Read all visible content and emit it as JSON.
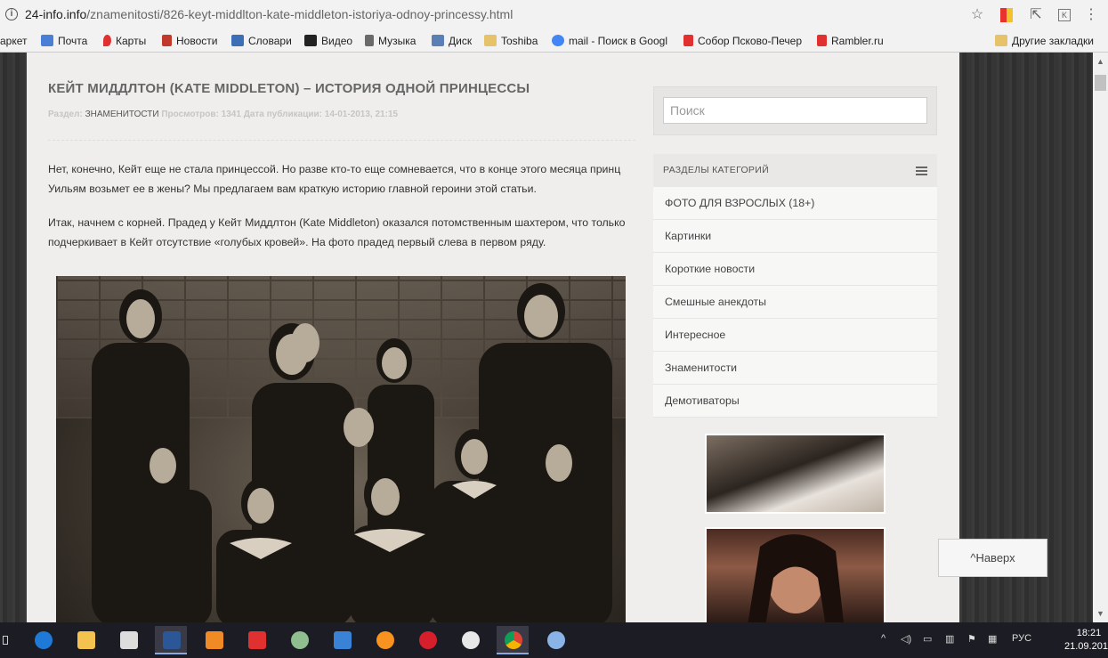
{
  "browser": {
    "url_host": "24-info.info",
    "url_path": "/znamenitosti/826-keyt-middlton-kate-middleton-istoriya-odnoy-princessy.html"
  },
  "bookmarks": [
    {
      "label": "аркет",
      "icon": "yandex-market-icon",
      "color": "#d9534f"
    },
    {
      "label": "Почта",
      "icon": "mail-icon",
      "color": "#4a7fd6"
    },
    {
      "label": "Карты",
      "icon": "map-pin-icon",
      "color": "#e03030"
    },
    {
      "label": "Новости",
      "icon": "news-icon",
      "color": "#c0392b"
    },
    {
      "label": "Словари",
      "icon": "dictionary-icon",
      "color": "#3c6fb5"
    },
    {
      "label": "Видео",
      "icon": "video-icon",
      "color": "#222222"
    },
    {
      "label": "Музыка",
      "icon": "music-icon",
      "color": "#6a6a6a"
    },
    {
      "label": "Диск",
      "icon": "disk-icon",
      "color": "#5a7fb5"
    },
    {
      "label": "Toshiba",
      "icon": "folder-icon",
      "color": "#e6c36a"
    },
    {
      "label": "mail - Поиск в Googl",
      "icon": "google-icon",
      "color": "#4285f4"
    },
    {
      "label": "Собор Псково-Печер",
      "icon": "yandex-icon",
      "color": "#e03030"
    },
    {
      "label": "Rambler.ru",
      "icon": "yandex-icon",
      "color": "#e03030"
    }
  ],
  "other_bookmarks": "Другие закладки",
  "article": {
    "title": "КЕЙТ МИДДЛТОН (KATE MIDDLETON) – ИСТОРИЯ ОДНОЙ ПРИНЦЕССЫ",
    "meta_section_label": "Раздел:",
    "meta_section": "ЗНАМЕНИТОСТИ",
    "meta_views_label": "Просмотров:",
    "meta_views": "1341",
    "meta_date_label": "Дата публикации:",
    "meta_date": "14-01-2013, 21:15",
    "paragraph1": "Нет, конечно, Кейт еще не стала принцессой. Но разве кто-то еще сомневается, что в конце этого месяца принц Уильям возьмет ее в жены? Мы предлагаем вам краткую историю главной героини этой статьи.",
    "paragraph2": "Итак, начнем с корней. Прадед у Кейт Миддлтон (Kate Middleton) оказался потомственным шахтером, что только подчеркивает в Кейт отсутствие «голубых кровей». На фото прадед первый слева в первом ряду."
  },
  "sidebar": {
    "search_placeholder": "Поиск",
    "categories_title": "РАЗДЕЛЫ КАТЕГОРИЙ",
    "categories": [
      "ФОТО ДЛЯ ВЗРОСЛЫХ (18+)",
      "Картинки",
      "Короткие новости",
      "Смешные анекдоты",
      "Интересное",
      "Знаменитости",
      "Демотиваторы"
    ]
  },
  "scroll_top_label": "^Наверх",
  "taskbar": {
    "lang": "РУС",
    "time": "18:21",
    "date": "21.09.2016",
    "apps": [
      {
        "icon": "edge-icon",
        "color": "#1e7ad6"
      },
      {
        "icon": "file-explorer-icon",
        "color": "#f3c24f"
      },
      {
        "icon": "store-icon",
        "color": "#dddddd"
      },
      {
        "icon": "word-icon",
        "color": "#2b5797"
      },
      {
        "icon": "media-player-icon",
        "color": "#f08a24"
      },
      {
        "icon": "yandex-icon",
        "color": "#e03030"
      },
      {
        "icon": "app-circle-icon",
        "color": "#8fbf8f"
      },
      {
        "icon": "mail-app-icon",
        "color": "#3a82d6"
      },
      {
        "icon": "odnoklassniki-icon",
        "color": "#f7931e"
      },
      {
        "icon": "opera-icon",
        "color": "#d51f2b"
      },
      {
        "icon": "yandex-browser-icon",
        "color": "#e8e8e8"
      },
      {
        "icon": "chrome-icon",
        "color": "#2ba24c"
      },
      {
        "icon": "paint-icon",
        "color": "#8ab4e8"
      }
    ]
  }
}
